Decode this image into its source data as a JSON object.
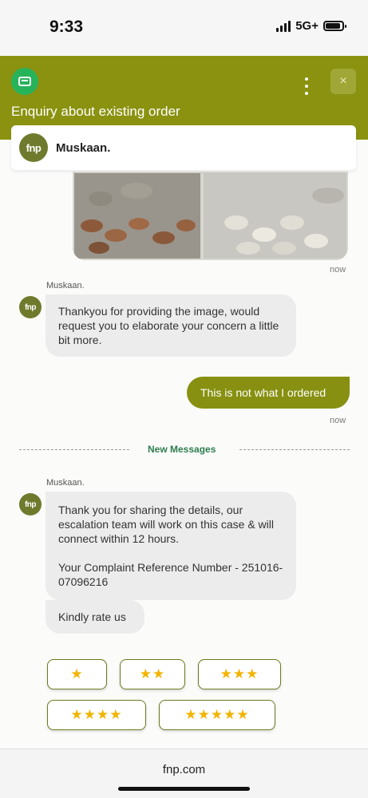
{
  "status_bar": {
    "time": "9:33",
    "network": "5G+"
  },
  "header": {
    "title": "Enquiry about existing order",
    "close_icon": "×"
  },
  "agent": {
    "name": "Muskaan.",
    "logo_text": "fnp"
  },
  "messages": {
    "photo_time": "now",
    "m1_sender": "Muskaan.",
    "m1_text": "Thankyou for providing the image, would request you to elaborate your concern a little bit more.",
    "user_text": "This is not what I ordered",
    "user_time": "now",
    "new_messages_label": "New Messages",
    "m2_sender": "Muskaan.",
    "m2_line1": "Thank you for sharing the details, our escalation team will work on this case & will connect within 12 hours.",
    "m2_line2": "Your Complaint Reference Number - 251016-07096216",
    "m3_text": "Kindly rate us"
  },
  "ratings": [
    "★",
    "★★",
    "★★★",
    "★★★★",
    "★★★★★"
  ],
  "footer": {
    "url": "fnp.com"
  },
  "colors": {
    "header": "#8a9210",
    "accent_green": "#27b35a",
    "user_bubble": "#879010",
    "star": "#f2b400"
  }
}
